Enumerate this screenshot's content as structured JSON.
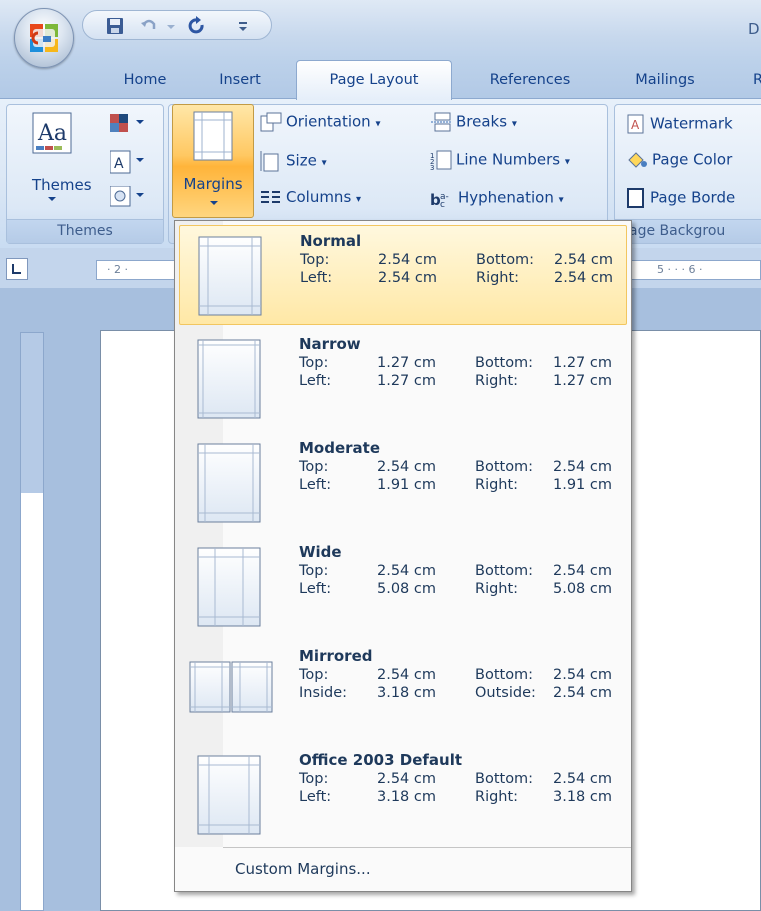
{
  "title_bar": {
    "title_partial": "D"
  },
  "tabs": [
    "Home",
    "Insert",
    "Page Layout",
    "References",
    "Mailings",
    "R"
  ],
  "ribbon": {
    "themes_label": "Themes",
    "themes_group_label": "Themes",
    "margins_label": "Margins",
    "orientation_label": "Orientation",
    "size_label": "Size",
    "columns_label": "Columns",
    "breaks_label": "Breaks",
    "line_numbers_label": "Line Numbers",
    "hyphenation_label": "Hyphenation",
    "watermark_label": "Watermark",
    "page_color_label": "Page Color",
    "page_borders_label": "Page Borde",
    "page_background_group_label": "age Backgrou"
  },
  "ruler": {
    "left_text": "· 2 ·",
    "right_text": "5 · · · 6 ·"
  },
  "margins_menu": {
    "options": [
      {
        "title": "Normal",
        "row1": [
          "Top:",
          "2.54 cm",
          "Bottom:",
          "2.54 cm"
        ],
        "row2": [
          "Left:",
          "2.54 cm",
          "Right:",
          "2.54 cm"
        ],
        "selected": true
      },
      {
        "title": "Narrow",
        "row1": [
          "Top:",
          "1.27 cm",
          "Bottom:",
          "1.27 cm"
        ],
        "row2": [
          "Left:",
          "1.27 cm",
          "Right:",
          "1.27 cm"
        ],
        "selected": false
      },
      {
        "title": "Moderate",
        "row1": [
          "Top:",
          "2.54 cm",
          "Bottom:",
          "2.54 cm"
        ],
        "row2": [
          "Left:",
          "1.91 cm",
          "Right:",
          "1.91 cm"
        ],
        "selected": false
      },
      {
        "title": "Wide",
        "row1": [
          "Top:",
          "2.54 cm",
          "Bottom:",
          "2.54 cm"
        ],
        "row2": [
          "Left:",
          "5.08 cm",
          "Right:",
          "5.08 cm"
        ],
        "selected": false
      },
      {
        "title": "Mirrored",
        "row1": [
          "Top:",
          "2.54 cm",
          "Bottom:",
          "2.54 cm"
        ],
        "row2": [
          "Inside:",
          "3.18 cm",
          "Outside:",
          "2.54 cm"
        ],
        "selected": false
      },
      {
        "title": "Office 2003 Default",
        "row1": [
          "Top:",
          "2.54 cm",
          "Bottom:",
          "2.54 cm"
        ],
        "row2": [
          "Left:",
          "3.18 cm",
          "Right:",
          "3.18 cm"
        ],
        "selected": false
      }
    ],
    "custom_label": "Custom Margins..."
  },
  "colors": {
    "accent": "#15428b",
    "selected_bg": "#ffe8a6",
    "margins_button": "#ffc862"
  }
}
